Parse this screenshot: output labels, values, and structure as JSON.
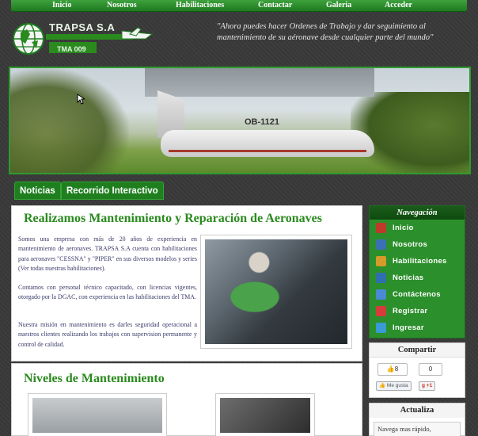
{
  "topnav": {
    "items": [
      "Inicio",
      "Nosotros",
      "Habilitaciones",
      "Contactar",
      "Galeria",
      "Acceder"
    ]
  },
  "logo": {
    "brand": "TRAPSA S.A",
    "sub": "TMA 009"
  },
  "tagline": "\"Ahora puedes hacer Ordenes de Trabajo y dar seguimiento al mantenimiento de su aéronave desde cualquier parte del mundo\"",
  "banner": {
    "registration": "OB-1121"
  },
  "tabs": [
    "Noticias",
    "Recorrido Interactivo"
  ],
  "main": {
    "title": "Realizamos Mantenimiento y Reparación de Aeronaves",
    "paragraphs": [
      "Somos una empresa con más de 20 años de experiencia en mantenimiento de aeronaves. TRAPSA S.A cuenta con habilitaciones para aeronaves \"CESSNA\" y \"PIPER\" en sus diversos modelos y series (Ver todas nuestras habilitaciones).",
      "Contamos con personal técnico capacitado, con licencias vigentes, otorgado por la DGAC, con experiencia en las habilitaciones del TMA.",
      "Nuestra misión en mantenimiento es darles seguridad operacional a nuestros clientes realizando los trabajos con supervision permanente y control de calidad."
    ]
  },
  "levels": {
    "title": "Niveles de Mantenimiento"
  },
  "sidebar": {
    "header": "Navegación",
    "items": [
      {
        "label": "Inicio",
        "icon": "home-icon",
        "color": "#c0392b"
      },
      {
        "label": "Nosotros",
        "icon": "users-icon",
        "color": "#3b6fb6"
      },
      {
        "label": "Habilitaciones",
        "icon": "tools-icon",
        "color": "#d49a2a"
      },
      {
        "label": "Noticias",
        "icon": "news-icon",
        "color": "#2f6fb0"
      },
      {
        "label": "Contáctenos",
        "icon": "phone-icon",
        "color": "#4a8ad4"
      },
      {
        "label": "Registrar",
        "icon": "register-icon",
        "color": "#d63b3b"
      },
      {
        "label": "Ingresar",
        "icon": "key-icon",
        "color": "#3a9ad4"
      }
    ]
  },
  "share": {
    "header": "Compartir",
    "like_count": "8",
    "plus_count": "0",
    "like_label": "Me gusta",
    "plus_label": "+1"
  },
  "update": {
    "header": "Actualiza",
    "text": "Navega mas rápido,"
  },
  "colors": {
    "brand_green": "#1f7f1f",
    "title_green": "#2a8a1e"
  }
}
